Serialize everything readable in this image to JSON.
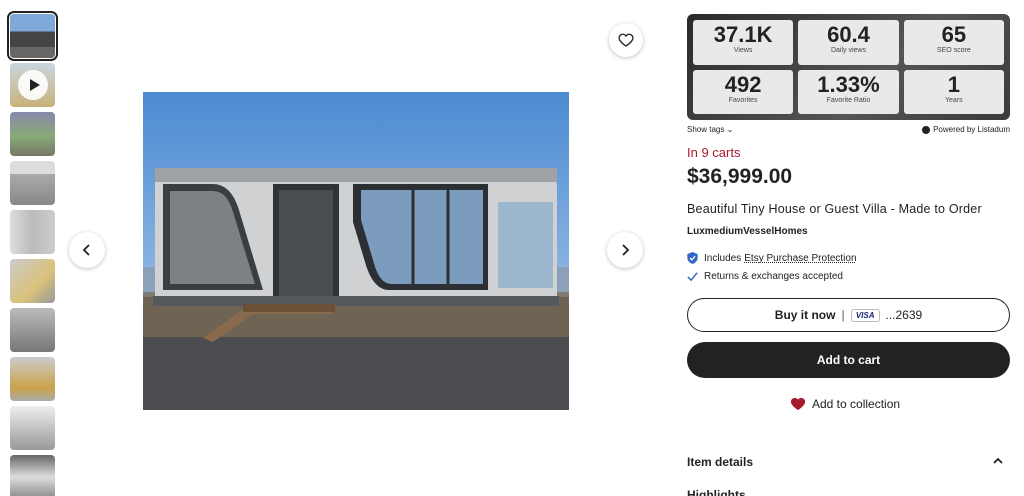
{
  "stats": [
    {
      "value": "37.1K",
      "label": "Views"
    },
    {
      "value": "60.4",
      "label": "Daily views"
    },
    {
      "value": "65",
      "label": "SEO score"
    },
    {
      "value": "492",
      "label": "Favorites"
    },
    {
      "value": "1.33%",
      "label": "Favorite Ratio"
    },
    {
      "value": "1",
      "label": "Years"
    }
  ],
  "show_tags": "Show tags",
  "powered_by": "Powered by Listadum",
  "in_carts": "In 9 carts",
  "price": "$36,999.00",
  "title": "Beautiful Tiny House or Guest Villa - Made to Order",
  "shop_name": "LuxmediumVesselHomes",
  "perks": {
    "purchase_prefix": "Includes",
    "purchase_link": "Etsy Purchase Protection",
    "returns": "Returns & exchanges accepted"
  },
  "buy_now": {
    "label": "Buy it now",
    "card": "VISA",
    "number": "...2639"
  },
  "add_to_cart": "Add to cart",
  "add_to_collection": "Add to collection",
  "item_details": "Item details",
  "highlights": "Highlights",
  "colors": {
    "accent": "#a61a2e",
    "dark": "#222222",
    "heart": "#a61a2e"
  }
}
